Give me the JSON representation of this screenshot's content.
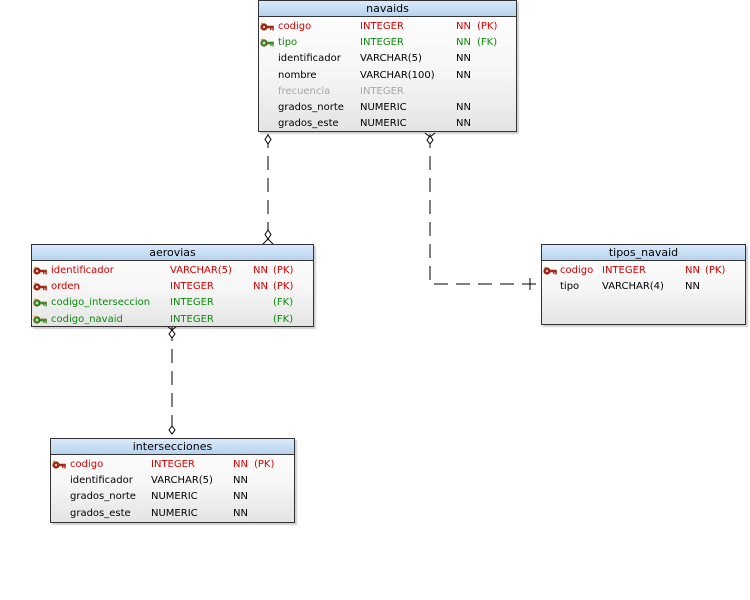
{
  "tables": {
    "navaids": {
      "title": "navaids",
      "columns": [
        {
          "name": "codigo",
          "type": "INTEGER",
          "nullability": "NN",
          "key": "(PK)",
          "role": "pk",
          "key_icon": "primary-key-icon"
        },
        {
          "name": "tipo",
          "type": "INTEGER",
          "nullability": "NN",
          "key": "(FK)",
          "role": "fk",
          "key_icon": "foreign-key-icon"
        },
        {
          "name": "identificador",
          "type": "VARCHAR(5)",
          "nullability": "NN",
          "key": "",
          "role": "normal"
        },
        {
          "name": "nombre",
          "type": "VARCHAR(100)",
          "nullability": "NN",
          "key": "",
          "role": "normal"
        },
        {
          "name": "frecuencia",
          "type": "INTEGER",
          "nullability": "",
          "key": "",
          "role": "gray"
        },
        {
          "name": "grados_norte",
          "type": "NUMERIC",
          "nullability": "NN",
          "key": "",
          "role": "normal"
        },
        {
          "name": "grados_este",
          "type": "NUMERIC",
          "nullability": "NN",
          "key": "",
          "role": "normal"
        }
      ]
    },
    "aerovias": {
      "title": "aerovias",
      "columns": [
        {
          "name": "identificador",
          "type": "VARCHAR(5)",
          "nullability": "NN",
          "key": "(PK)",
          "role": "pk",
          "key_icon": "primary-key-icon"
        },
        {
          "name": "orden",
          "type": "INTEGER",
          "nullability": "NN",
          "key": "(PK)",
          "role": "pk",
          "key_icon": "primary-key-icon"
        },
        {
          "name": "codigo_interseccion",
          "type": "INTEGER",
          "nullability": "",
          "key": "(FK)",
          "role": "fk",
          "key_icon": "foreign-key-icon"
        },
        {
          "name": "codigo_navaid",
          "type": "INTEGER",
          "nullability": "",
          "key": "(FK)",
          "role": "fk",
          "key_icon": "foreign-key-icon"
        }
      ]
    },
    "tipos_navaid": {
      "title": "tipos_navaid",
      "columns": [
        {
          "name": "codigo",
          "type": "INTEGER",
          "nullability": "NN",
          "key": "(PK)",
          "role": "pk",
          "key_icon": "primary-key-icon"
        },
        {
          "name": "tipo",
          "type": "VARCHAR(4)",
          "nullability": "NN",
          "key": "",
          "role": "normal"
        }
      ]
    },
    "intersecciones": {
      "title": "intersecciones",
      "columns": [
        {
          "name": "codigo",
          "type": "INTEGER",
          "nullability": "NN",
          "key": "(PK)",
          "role": "pk",
          "key_icon": "primary-key-icon"
        },
        {
          "name": "identificador",
          "type": "VARCHAR(5)",
          "nullability": "NN",
          "key": "",
          "role": "normal"
        },
        {
          "name": "grados_norte",
          "type": "NUMERIC",
          "nullability": "NN",
          "key": "",
          "role": "normal"
        },
        {
          "name": "grados_este",
          "type": "NUMERIC",
          "nullability": "NN",
          "key": "",
          "role": "normal"
        }
      ]
    }
  },
  "relationships": [
    {
      "from": "navaids",
      "to": "aerovias",
      "style": "dashed"
    },
    {
      "from": "navaids",
      "to": "tipos_navaid",
      "style": "dashed"
    },
    {
      "from": "aerovias",
      "to": "intersecciones",
      "style": "dashed"
    }
  ],
  "colors": {
    "header_fill": "#c9dff4",
    "border": "#333333",
    "pk_text": "#d40000",
    "fk_text": "#0a8a0a",
    "nullable_text": "#a6a6a6",
    "connector": "#000000"
  }
}
